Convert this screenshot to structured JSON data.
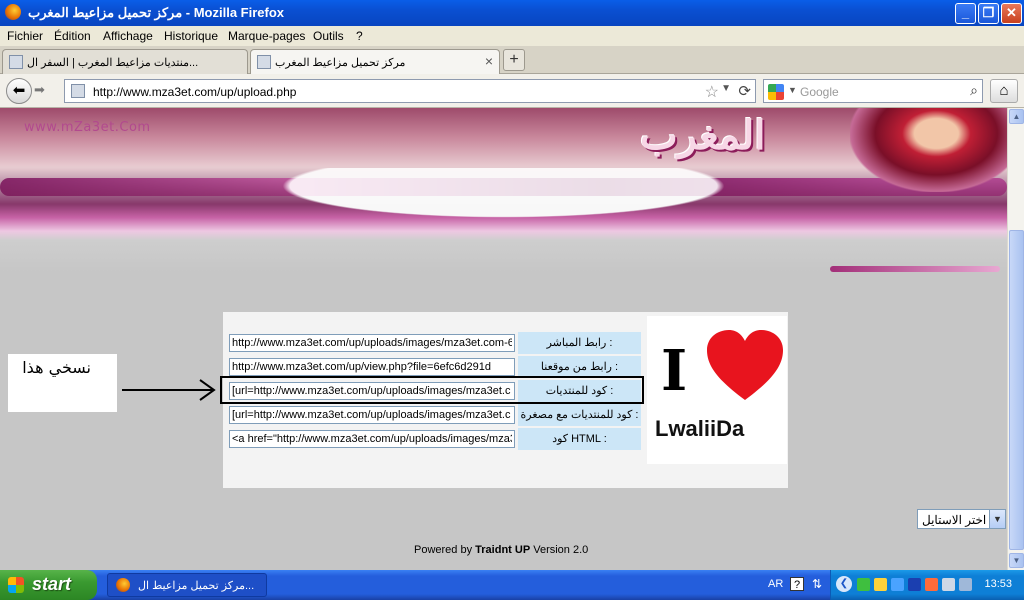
{
  "window": {
    "title": "مركز تحميل مزاعيط المغرب - Mozilla Firefox",
    "min": "_",
    "max": "❐",
    "close": "✕"
  },
  "menu": [
    "Fichier",
    "Édition",
    "Affichage",
    "Historique",
    "Marque-pages",
    "Outils",
    "?"
  ],
  "tabs": [
    {
      "label": "منتديات مزاعيط المغرب | السفر ال...",
      "close": "×"
    },
    {
      "label": "مركز تحميل مزاعيط المغرب",
      "close": "×"
    }
  ],
  "newtab_label": "+",
  "nav": {
    "url": "http://www.mza3et.com/up/upload.php",
    "search_placeholder": "Google"
  },
  "banner": {
    "site": "www.mZa3et.Com",
    "arabic": "المغرب"
  },
  "fields": [
    {
      "value": "http://www.mza3et.com/up/uploads/images/mza3et.com-6",
      "label": "رابط المباشر :"
    },
    {
      "value": "http://www.mza3et.com/up/view.php?file=6efc6d291d",
      "label": "رابط من موقعنا :"
    },
    {
      "value": "[url=http://www.mza3et.com/up/uploads/images/mza3et.c",
      "label": "كود للمنتديات :"
    },
    {
      "value": "[url=http://www.mza3et.com/up/uploads/images/mza3et.c",
      "label": "كود للمنتديات مع مصغرة :"
    },
    {
      "value": "<a href=\"http://www.mza3et.com/up/uploads/images/mza3",
      "label": "كود HTML :"
    }
  ],
  "logo": {
    "i": "I",
    "name": "LwaliiDa",
    "heart_color": "#e8141e"
  },
  "annotation": "نسخي هذا",
  "style_select": "اختر الاستايل",
  "powered": {
    "prefix": "Powered by ",
    "brand": "Traidnt UP",
    "suffix": " Version 2.0"
  },
  "taskbar": {
    "start": "start",
    "item": "مركز تحميل مزاعيط ال...",
    "lang": "AR",
    "help": "?",
    "clock": "13:53"
  }
}
